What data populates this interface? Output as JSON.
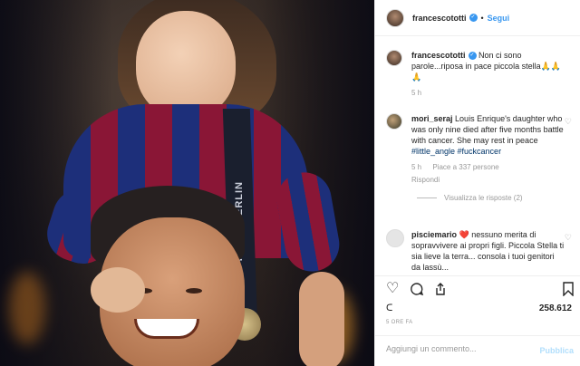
{
  "photo": {
    "ribbon_text": "FINAL BERLIN"
  },
  "header": {
    "username": "francescototti",
    "follow_label": "Segui"
  },
  "caption": {
    "username": "francescototti",
    "text": "Non ci sono parole...riposa in pace piccola stella🙏🙏🙏",
    "time": "5 h"
  },
  "comments": [
    {
      "username": "mori_seraj",
      "text": "Louis Enrique's daughter who was only nine died after five months battle with cancer. She may rest in peace",
      "tags": "#little_angle #fuckcancer",
      "time": "5 h",
      "likes": "Piace a 337 persone",
      "reply_label": "Rispondi",
      "view_replies": "Visualizza le risposte (2)"
    },
    {
      "username": "pisciemario",
      "heart": "❤️",
      "text": "nessuno merita di sopravvivere ai propri figli. Piccola Stella ti sia lieve la terra... consola i tuoi genitori da lassù..."
    }
  ],
  "actions": {
    "like_icon": "heart-outline-icon",
    "comment_icon": "comment-icon",
    "share_icon": "share-icon",
    "save_icon": "bookmark-icon"
  },
  "likes": {
    "prefix": "ᑕ",
    "count": "258.612"
  },
  "post_time": "5 ORE FA",
  "comment_box": {
    "placeholder": "Aggiungi un commento...",
    "publish_label": "Pubblica"
  },
  "colors": {
    "accent": "#3897f0",
    "publish_disabled": "#b2dffc",
    "hashtag": "#003569",
    "secondary_text": "#999999"
  }
}
